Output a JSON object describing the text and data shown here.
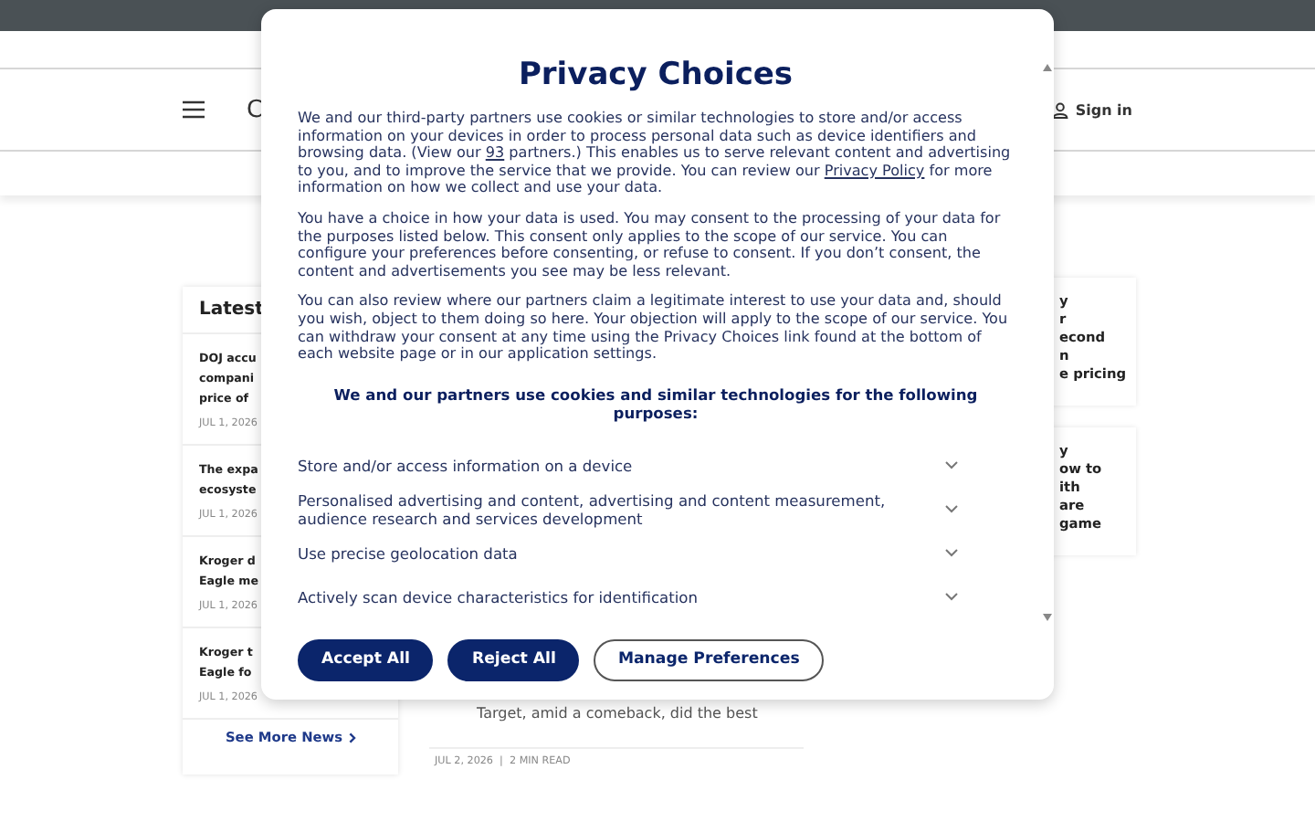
{
  "header": {
    "logo_fragment": "C",
    "sign_in": "Sign in"
  },
  "latest": {
    "title": "Latest",
    "items": [
      {
        "headline": "DOJ accu\ncompani\nprice of",
        "date": "JUL 1, 2026"
      },
      {
        "headline": "The expa\necosyste",
        "date": "JUL 1, 2026"
      },
      {
        "headline": "Kroger d\nEagle me",
        "date": "JUL 1, 2026"
      },
      {
        "headline": "Kroger t\nEagle fo",
        "date": "JUL 1, 2026"
      }
    ],
    "more": "See More News"
  },
  "article": {
    "snippet": "Target, amid a comeback, did the best",
    "meta": "JUL 2, 2026  |  2 MIN READ"
  },
  "side_cards": [
    {
      "lines": [
        "y",
        "r",
        "econd",
        "n",
        "e pricing"
      ]
    },
    {
      "lines": [
        "y",
        "ow to",
        "ith",
        "are",
        "game"
      ]
    }
  ],
  "modal": {
    "title": "Privacy Choices",
    "paragraphs": [
      {
        "segments": [
          {
            "kind": "text",
            "text": "We and our third-party partners use cookies or similar technologies to store and/or access information on your devices in order to process personal data such as device identifiers and browsing data. (View our "
          },
          {
            "kind": "link",
            "text": "93"
          },
          {
            "kind": "text",
            "text": " partners.) This enables us to serve relevant content and advertising to you, and to improve the service that we provide. You can review our "
          },
          {
            "kind": "link",
            "text": "Privacy Policy"
          },
          {
            "kind": "text",
            "text": " for more information on how we collect and use your data."
          }
        ]
      },
      {
        "segments": [
          {
            "kind": "text",
            "text": "You have a choice in how your data is used. You may consent to the processing of your data for the purposes listed below. This consent only applies to the scope of our service. You can configure your preferences before consenting, or refuse to consent. If you don’t consent, the content and advertisements you see may be less relevant."
          }
        ]
      },
      {
        "segments": [
          {
            "kind": "text",
            "text": "You can also review where our partners claim a legitimate interest to use your data and, should you wish, object to them doing so here. Your objection will apply to the scope of our service. You can withdraw your consent at any time using the Privacy Choices link found at the bottom of each website page or in our application settings."
          }
        ]
      }
    ],
    "purposes_heading": "We and our partners use cookies and similar technologies for the following purposes:",
    "purposes": [
      {
        "label": "Store and/or access information on a device",
        "expanded": false
      },
      {
        "label": "Personalised advertising and content, advertising and content measurement, audience research and services development",
        "expanded": false
      },
      {
        "label": "Use precise geolocation data",
        "expanded": false
      },
      {
        "label": "Actively scan device characteristics for identification",
        "expanded": false
      }
    ],
    "buttons": [
      {
        "label": "Accept All",
        "kind": "primary"
      },
      {
        "label": "Reject All",
        "kind": "primary"
      },
      {
        "label": "Manage Preferences",
        "kind": "outline"
      }
    ]
  }
}
